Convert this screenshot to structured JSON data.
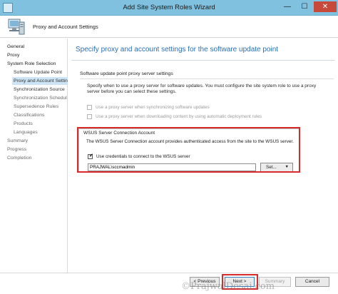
{
  "window": {
    "title": "Add Site System Roles Wizard",
    "minimize_glyph": "—",
    "maximize_glyph": "☐",
    "close_glyph": "✕"
  },
  "header": {
    "page_name": "Proxy and Account Settings",
    "icon": "server-computer-icon"
  },
  "sidebar": {
    "items": [
      {
        "label": "General"
      },
      {
        "label": "Proxy"
      },
      {
        "label": "System Role Selection"
      },
      {
        "label": "Software Update Point"
      },
      {
        "label": "Proxy and Account Settings"
      },
      {
        "label": "Synchronization Source"
      },
      {
        "label": "Synchronization Schedule"
      },
      {
        "label": "Supersedence Rules"
      },
      {
        "label": "Classifications"
      },
      {
        "label": "Products"
      },
      {
        "label": "Languages"
      },
      {
        "label": "Summary"
      },
      {
        "label": "Progress"
      },
      {
        "label": "Completion"
      }
    ]
  },
  "main": {
    "heading": "Specify proxy and account settings for the software update point",
    "proxy_section": {
      "label": "Software update point proxy server settings",
      "description": "Specify when to use a proxy server for software updates. You must configure the site system role to use a proxy server before you can select these settings.",
      "options": [
        {
          "label": "Use a proxy server when synchronizing software updates",
          "checked": false,
          "enabled": false
        },
        {
          "label": "Use a proxy server when downloading content by using automatic deployment rules",
          "checked": false,
          "enabled": false
        }
      ]
    },
    "wsus_section": {
      "title": "WSUS Server Connection Account",
      "description": "The WSUS Server Connection account provides authenticated access from the site to the WSUS server.",
      "use_credentials_label": "Use credentials to connect to the WSUS server",
      "use_credentials_checked": true,
      "account_value": "PRAJWAL\\sccmadmin",
      "set_button_label": "Set...",
      "set_caret": "▼"
    }
  },
  "footer": {
    "previous_label": "< Previous",
    "next_label": "Next >",
    "summary_label": "Summary",
    "cancel_label": "Cancel"
  },
  "watermark": "©PrajwalDesai.com",
  "colors": {
    "title_bar": "#7fc1de",
    "heading": "#2b6fb5",
    "highlight": "#d82a2a",
    "selected_nav": "#cce4f5"
  }
}
